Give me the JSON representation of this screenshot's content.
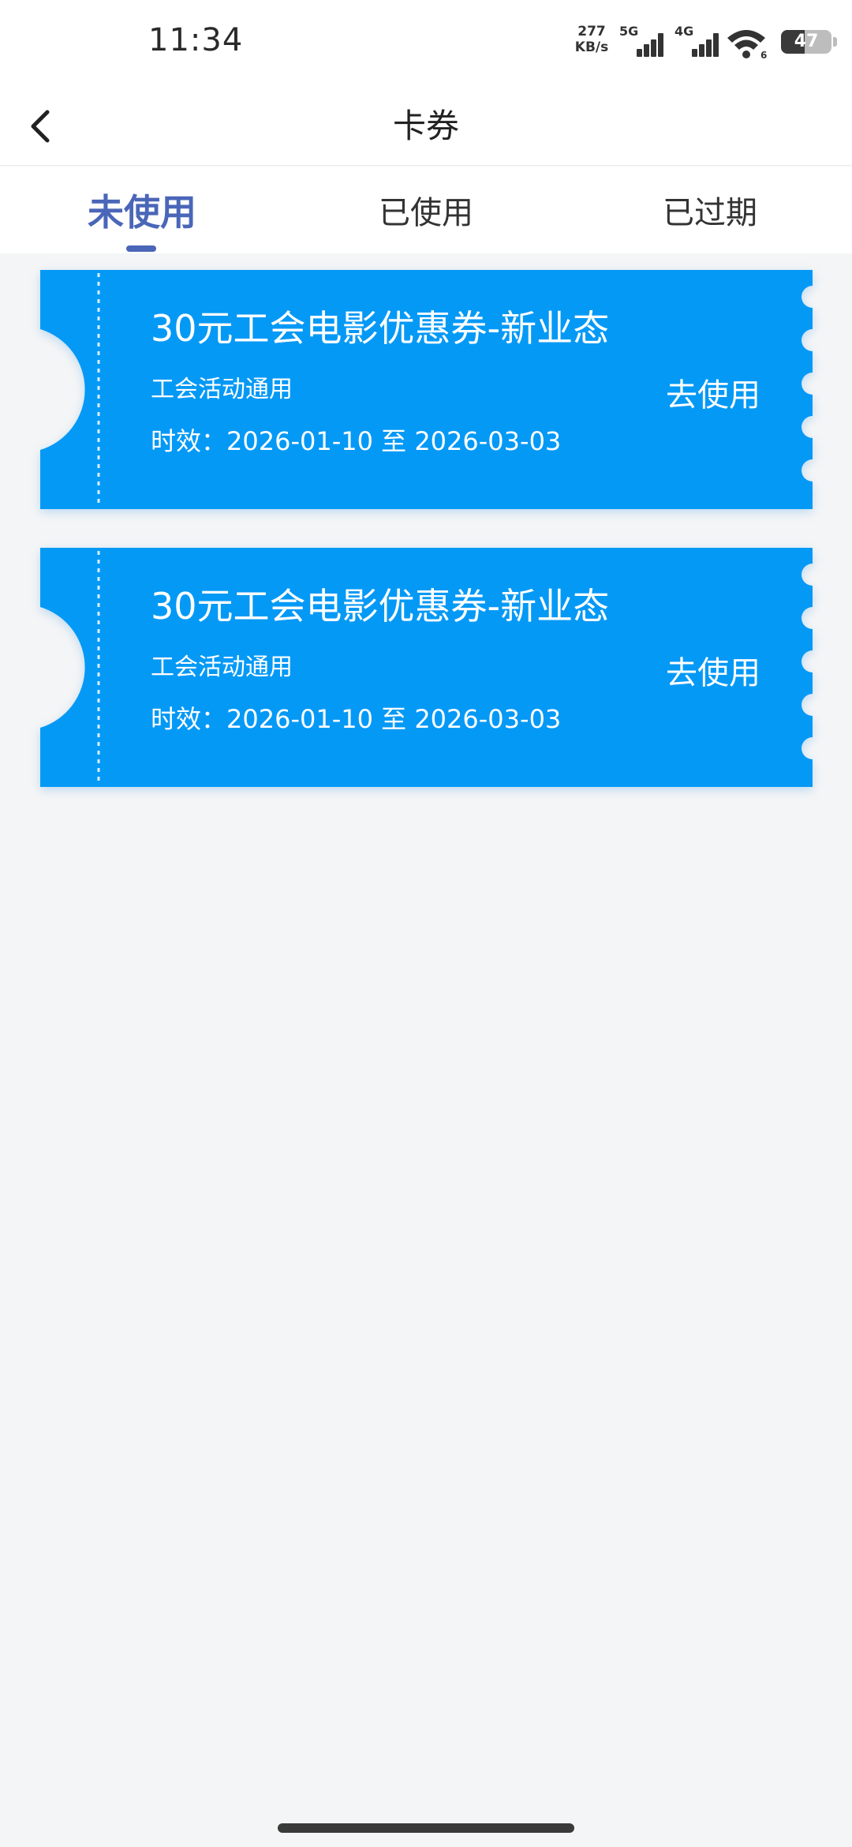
{
  "status_bar": {
    "time": "11:34",
    "speed_value": "277",
    "speed_unit": "KB/s",
    "sim1": "5G",
    "sim2": "4G",
    "wifi_badge": "6",
    "battery": "47",
    "battery_level": 0.47
  },
  "nav": {
    "title": "卡券",
    "back_icon": "chevron-left-icon"
  },
  "tabs": [
    {
      "label": "未使用",
      "active": true
    },
    {
      "label": "已使用",
      "active": false
    },
    {
      "label": "已过期",
      "active": false
    }
  ],
  "coupons": [
    {
      "title": "30元工会电影优惠券-新业态",
      "desc": "工会活动通用",
      "validity": "时效：2026-01-10 至 2026-03-03",
      "action": "去使用"
    },
    {
      "title": "30元工会电影优惠券-新业态",
      "desc": "工会活动通用",
      "validity": "时效：2026-01-10 至 2026-03-03",
      "action": "去使用"
    }
  ],
  "colors": {
    "coupon_bg": "#0599f6",
    "accent": "#4a66b8",
    "page_bg": "#f4f5f6"
  }
}
